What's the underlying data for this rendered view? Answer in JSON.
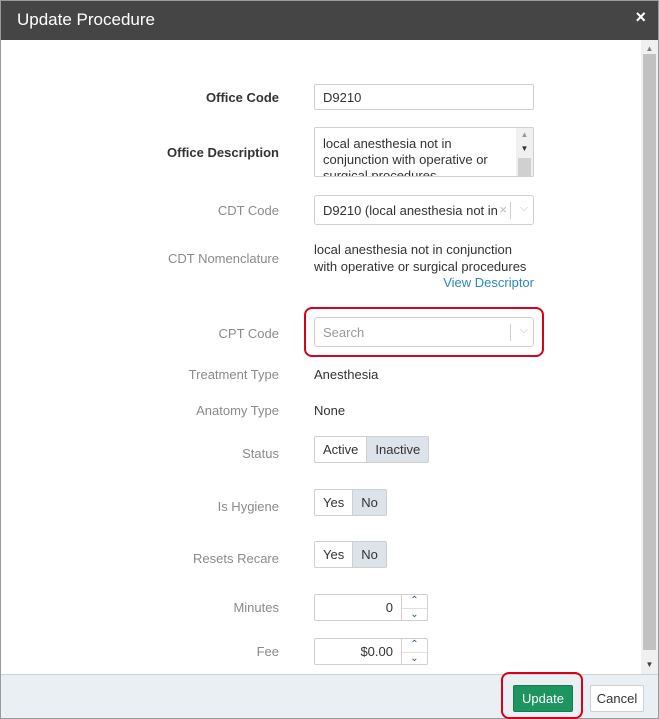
{
  "dialog": {
    "title": "Update Procedure",
    "close_icon": "×"
  },
  "form": {
    "office_code": {
      "label": "Office Code",
      "value": "D9210"
    },
    "office_description": {
      "label": "Office Description",
      "value": "local anesthesia not in conjunction with operative or surgical procedures"
    },
    "cdt_code": {
      "label": "CDT Code",
      "value": "D9210 (local anesthesia not in",
      "clear_icon": "×",
      "chevron_icon": "⌵"
    },
    "cdt_nomenclature": {
      "label": "CDT Nomenclature",
      "line1": "local anesthesia not in conjunction",
      "line2": "with operative or surgical procedures",
      "link": "View Descriptor"
    },
    "cpt_code": {
      "label": "CPT Code",
      "placeholder": "Search",
      "chevron_icon": "⌵"
    },
    "treatment_type": {
      "label": "Treatment Type",
      "value": "Anesthesia"
    },
    "anatomy_type": {
      "label": "Anatomy Type",
      "value": "None"
    },
    "status": {
      "label": "Status",
      "options": [
        "Active",
        "Inactive"
      ],
      "selected": "Inactive"
    },
    "is_hygiene": {
      "label": "Is Hygiene",
      "options": [
        "Yes",
        "No"
      ],
      "selected": "No"
    },
    "resets_recare": {
      "label": "Resets Recare",
      "options": [
        "Yes",
        "No"
      ],
      "selected": "No"
    },
    "minutes": {
      "label": "Minutes",
      "value": "0"
    },
    "fee": {
      "label": "Fee",
      "value": "$0.00"
    }
  },
  "footer": {
    "update_label": "Update",
    "cancel_label": "Cancel"
  },
  "colors": {
    "titlebar": "#454545",
    "primary_button": "#1e9461",
    "highlight": "#d9001b",
    "link": "#2a88bd"
  }
}
